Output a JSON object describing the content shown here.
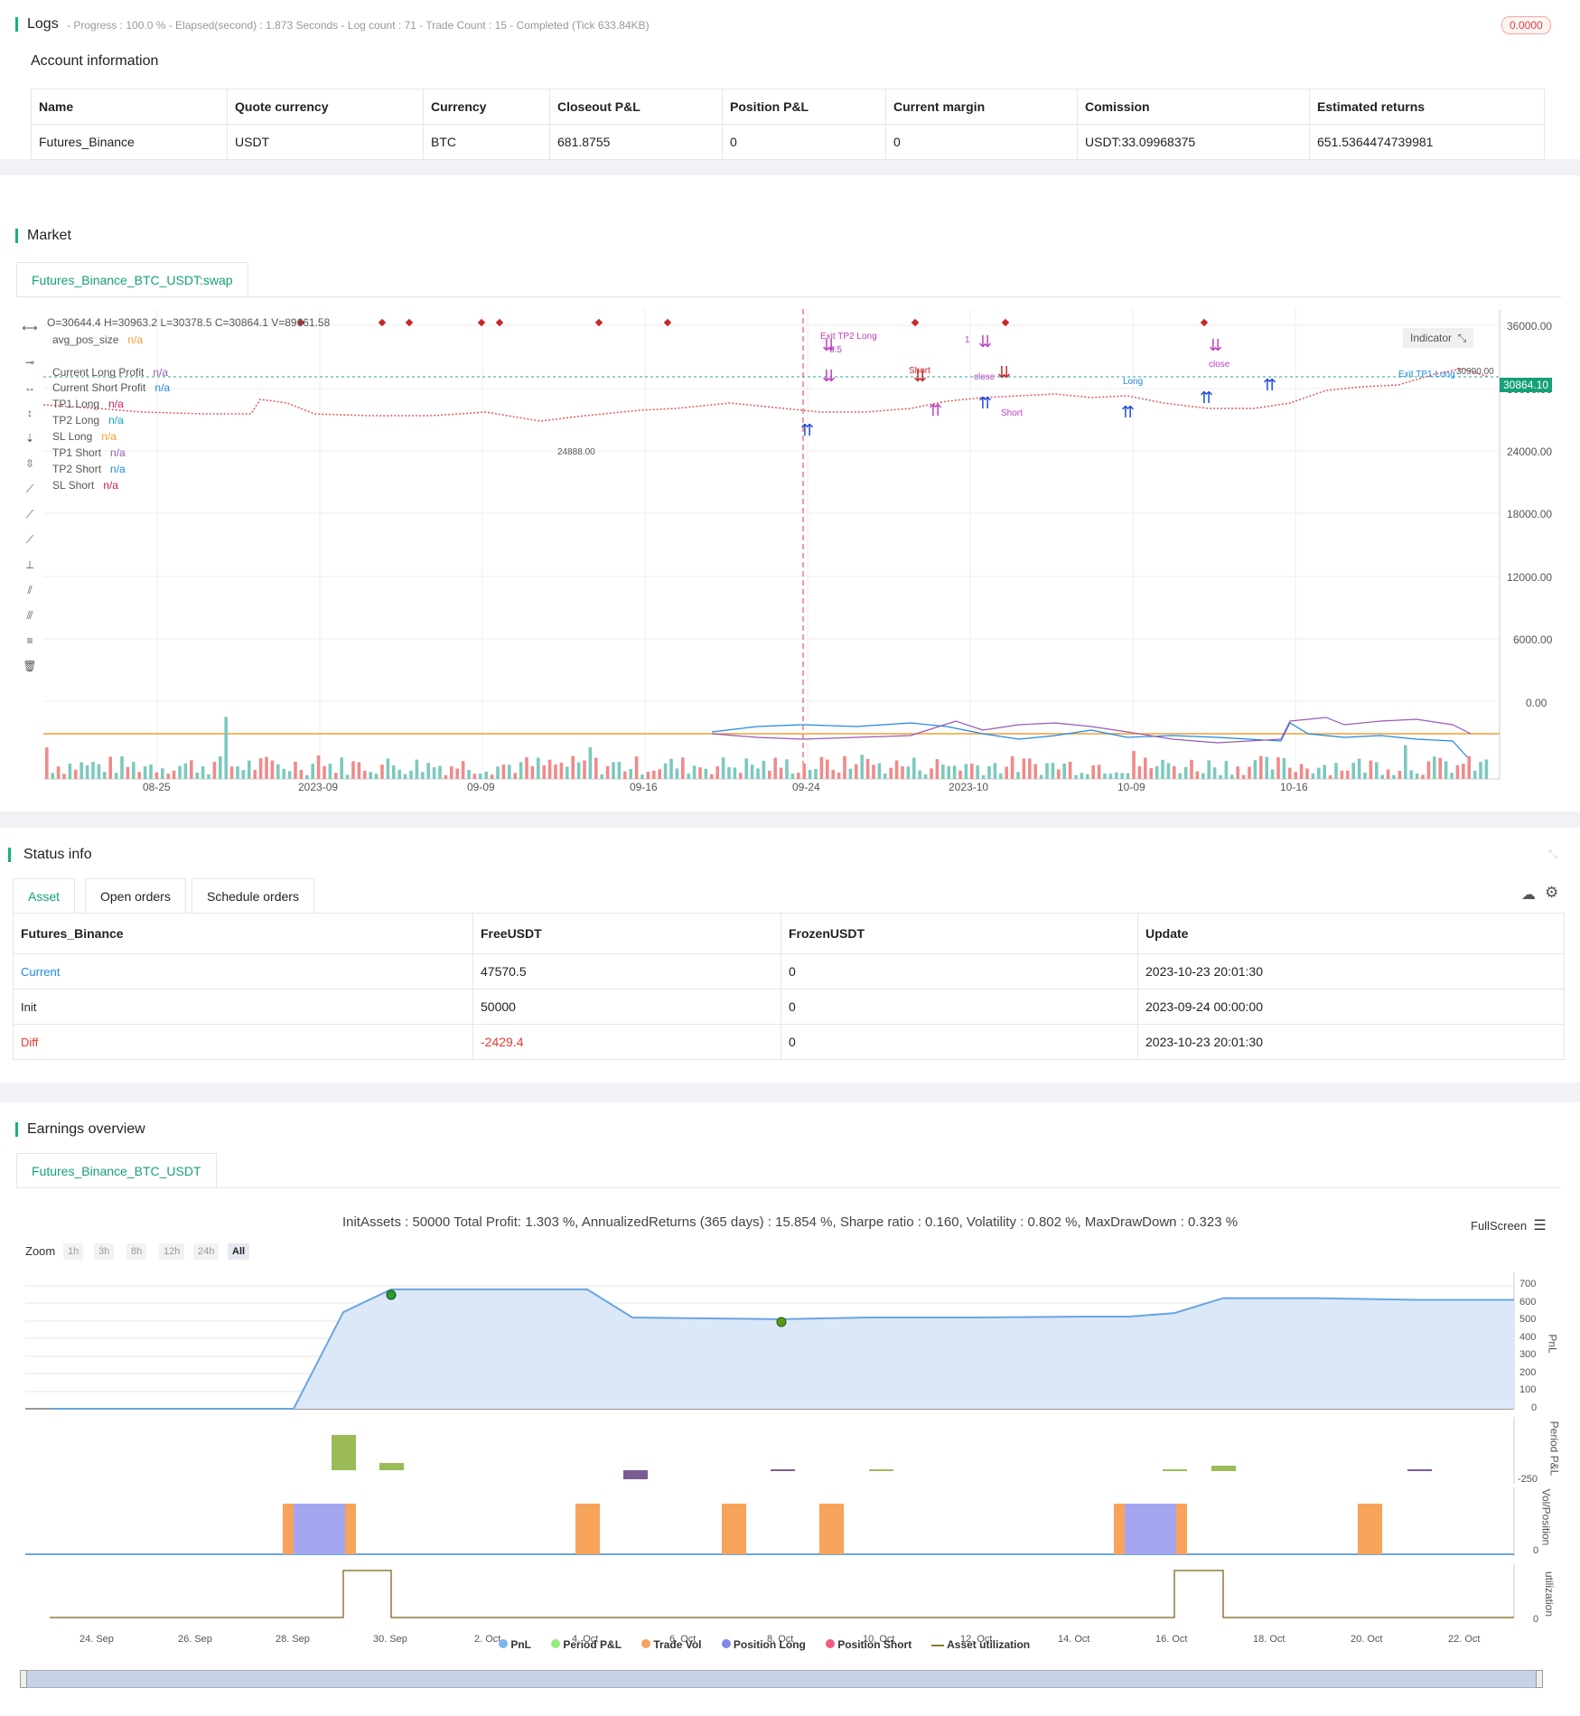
{
  "logs": {
    "title": "Logs",
    "summary": "- Progress : 100.0 % - Elapsed(second) : 1.873  Seconds - Log count : 71 - Trade Count : 15 - Completed (Tick 633.84KB)",
    "badge": "0.0000"
  },
  "account": {
    "title": "Account information",
    "headers": [
      "Name",
      "Quote currency",
      "Currency",
      "Closeout P&L",
      "Position P&L",
      "Current margin",
      "Comission",
      "Estimated returns"
    ],
    "row": [
      "Futures_Binance",
      "USDT",
      "BTC",
      "681.8755",
      "0",
      "0",
      "USDT:33.09968375",
      "651.5364474739981"
    ]
  },
  "market": {
    "title": "Market",
    "tab": "Futures_Binance_BTC_USDT:swap",
    "ohlc": "O=30644.4 H=30963.2 L=30378.5 C=30864.1 V=89661.58",
    "indicator_button": "Indicator",
    "legend": [
      {
        "label": "avg_pos_size",
        "value": "n/a"
      },
      {
        "label": "Current Long Profit",
        "value": "n/a"
      },
      {
        "label": "Current Short Profit",
        "value": "n/a"
      },
      {
        "label": "TP1 Long",
        "value": "n/a"
      },
      {
        "label": "TP2 Long",
        "value": "n/a"
      },
      {
        "label": "SL Long",
        "value": "n/a"
      },
      {
        "label": "TP1 Short",
        "value": "n/a"
      },
      {
        "label": "TP2 Short",
        "value": "n/a"
      },
      {
        "label": "SL Short",
        "value": "n/a"
      }
    ],
    "price_axis": [
      "36000.00",
      "30000.00",
      "24000.00",
      "18000.00",
      "12000.00",
      "6000.00",
      "0.00"
    ],
    "current_price": "30864.10",
    "high_label": "30990.00",
    "low_label": "24888.00",
    "date_axis": [
      "08-25",
      "2023-09",
      "09-09",
      "09-16",
      "09-24",
      "2023-10",
      "10-09",
      "10-16"
    ],
    "chart_annotations": [
      "Exit TP2 Long",
      "Short",
      "close",
      "Long",
      "Short",
      "close",
      "Exit TP1 Long",
      "1",
      "0.5"
    ]
  },
  "status": {
    "title": "Status info",
    "tabs": [
      "Asset",
      "Open orders",
      "Schedule orders"
    ],
    "headers": [
      "Futures_Binance",
      "FreeUSDT",
      "FrozenUSDT",
      "Update"
    ],
    "rows": [
      {
        "name": "Current",
        "free": "47570.5",
        "frozen": "0",
        "update": "2023-10-23 20:01:30"
      },
      {
        "name": "Init",
        "free": "50000",
        "frozen": "0",
        "update": "2023-09-24 00:00:00"
      },
      {
        "name": "Diff",
        "free": "-2429.4",
        "frozen": "0",
        "update": "2023-10-23 20:01:30"
      }
    ]
  },
  "earnings": {
    "title": "Earnings overview",
    "tab": "Futures_Binance_BTC_USDT",
    "summary": "InitAssets : 50000 Total Profit: 1.303 %, AnnualizedReturns (365 days) : 15.854 %, Sharpe ratio : 0.160, Volatility : 0.802 %, MaxDrawDown : 0.323 %",
    "fullscreen": "FullScreen",
    "zoom_label": "Zoom",
    "zoom_options": [
      "1h",
      "3h",
      "8h",
      "12h",
      "24h",
      "All"
    ],
    "pnl_axis": [
      "700",
      "600",
      "500",
      "400",
      "300",
      "200",
      "100",
      "0"
    ],
    "pnl_axis_title": "PnL",
    "period_axis_title": "Period P&L",
    "period_axis_value": "-250",
    "vol_axis_title": "Vol/Position",
    "vol_axis_value": "0",
    "util_axis_title": "utilization",
    "util_axis_value": "0",
    "date_axis": [
      "24. Sep",
      "26. Sep",
      "28. Sep",
      "30. Sep",
      "2. Oct",
      "4. Oct",
      "6. Oct",
      "8. Oct",
      "10. Oct",
      "12. Oct",
      "14. Oct",
      "16. Oct",
      "18. Oct",
      "20. Oct",
      "22. Oct"
    ],
    "legend": [
      {
        "label": "PnL",
        "color": "#7cb5ec"
      },
      {
        "label": "Period P&L",
        "color": "#90ed7d"
      },
      {
        "label": "Trade Vol",
        "color": "#f7a35c"
      },
      {
        "label": "Position Long",
        "color": "#8085e9"
      },
      {
        "label": "Position Short",
        "color": "#f15c80"
      },
      {
        "label": "Asset utilization",
        "color": "#8d7a3a"
      }
    ]
  },
  "chart_data": {
    "type": "line",
    "title": "",
    "xlabel": "",
    "ylabel": "PnL",
    "x": [
      "24. Sep",
      "26. Sep",
      "28. Sep",
      "29. Sep",
      "30. Sep",
      "3. Oct",
      "5. Oct",
      "8. Oct",
      "10. Oct",
      "12. Oct",
      "14. Oct",
      "15. Oct",
      "16. Oct",
      "18. Oct",
      "20. Oct",
      "22. Oct",
      "23. Oct"
    ],
    "series": [
      {
        "name": "PnL",
        "values": [
          0,
          0,
          0,
          550,
          680,
          680,
          520,
          510,
          520,
          520,
          525,
          525,
          545,
          630,
          630,
          620,
          620
        ]
      }
    ],
    "ylim": [
      0,
      700
    ]
  }
}
